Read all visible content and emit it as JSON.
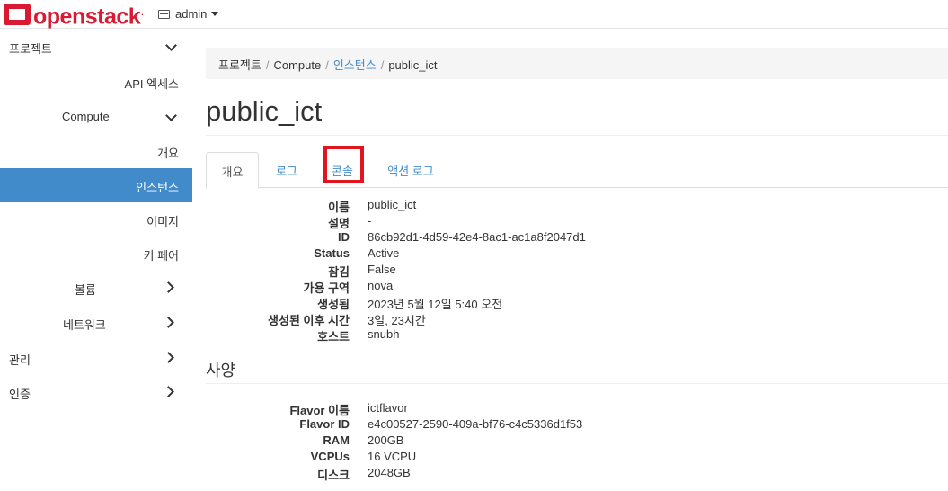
{
  "navbar": {
    "brand": "openstack",
    "brand_mark": ".",
    "project": "admin"
  },
  "sidebar": {
    "items": [
      {
        "label": "프로젝트"
      },
      {
        "label": "API 엑세스"
      },
      {
        "label": "Compute"
      },
      {
        "label": "개요"
      },
      {
        "label": "인스턴스"
      },
      {
        "label": "이미지"
      },
      {
        "label": "키 페어"
      },
      {
        "label": "볼륨"
      },
      {
        "label": "네트워크"
      },
      {
        "label": "관리"
      },
      {
        "label": "인증"
      }
    ]
  },
  "breadcrumb": {
    "items": [
      "프로젝트",
      "Compute",
      "인스턴스",
      "public_ict"
    ],
    "separator": "/"
  },
  "page": {
    "title": "public_ict"
  },
  "tabs": [
    {
      "label": "개요"
    },
    {
      "label": "로그"
    },
    {
      "label": "콘솔"
    },
    {
      "label": "액션 로그"
    }
  ],
  "overview": [
    {
      "label": "이름",
      "value": "public_ict"
    },
    {
      "label": "설명",
      "value": "-"
    },
    {
      "label": "ID",
      "value": "86cb92d1-4d59-42e4-8ac1-ac1a8f2047d1"
    },
    {
      "label": "Status",
      "value": "Active"
    },
    {
      "label": "잠김",
      "value": "False"
    },
    {
      "label": "가용 구역",
      "value": "nova"
    },
    {
      "label": "생성됨",
      "value": "2023년 5월 12일 5:40 오전"
    },
    {
      "label": "생성된 이후 시간",
      "value": "3일, 23시간"
    },
    {
      "label": "호스트",
      "value": "snubh"
    }
  ],
  "spec": {
    "title": "사양",
    "rows": [
      {
        "label": "Flavor 이름",
        "value": "ictflavor"
      },
      {
        "label": "Flavor ID",
        "value": "e4c00527-2590-409a-bf76-c4c5336d1f53"
      },
      {
        "label": "RAM",
        "value": "200GB"
      },
      {
        "label": "VCPUs",
        "value": "16 VCPU"
      },
      {
        "label": "디스크",
        "value": "2048GB"
      }
    ]
  },
  "colors": {
    "brand": "#da1a32",
    "link": "#428bca",
    "active_bg": "#428bca",
    "highlight": "#e0151e"
  }
}
